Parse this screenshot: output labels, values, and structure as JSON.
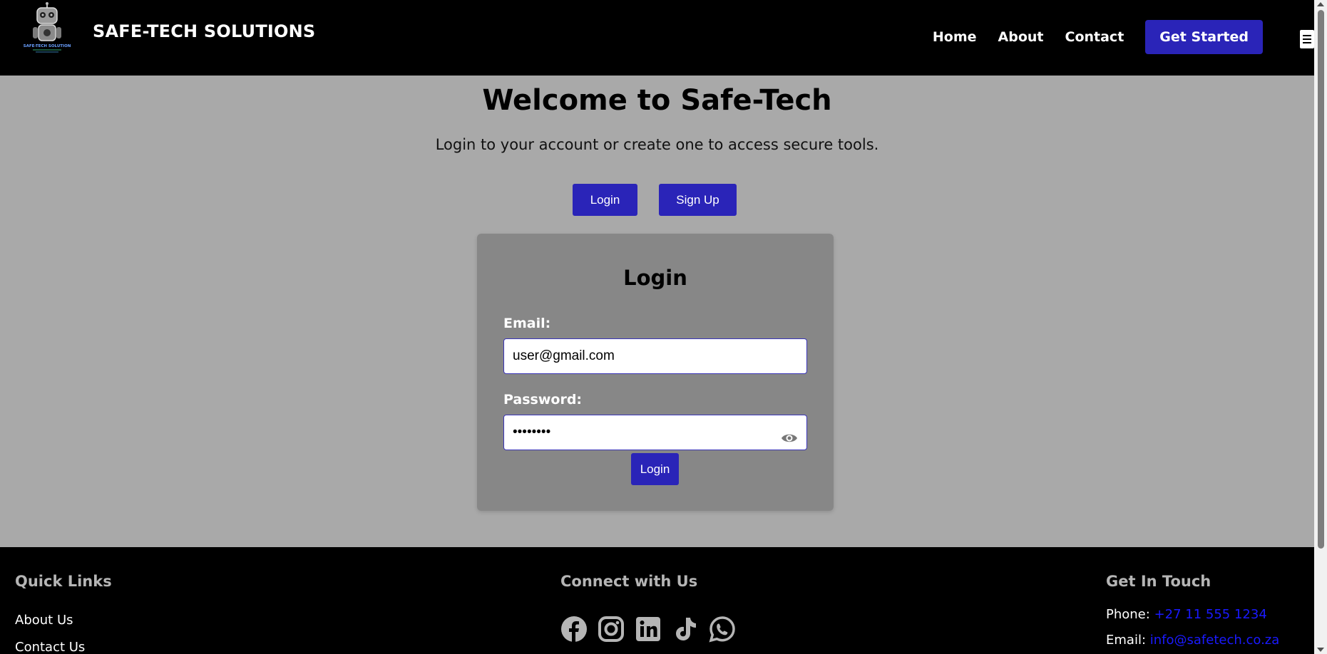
{
  "header": {
    "brand": "SAFE-TECH SOLUTIONS",
    "logo_icon": "robot-logo-icon",
    "logo_text": "SAFE-TECH SOLUTION",
    "nav": [
      {
        "label": "Home"
      },
      {
        "label": "About"
      },
      {
        "label": "Contact"
      }
    ],
    "cta_label": "Get Started",
    "menu_icon": "hamburger-menu-icon"
  },
  "hero": {
    "title": "Welcome to Safe-Tech",
    "subtitle": "Login to your account or create one to access secure tools.",
    "login_toggle": "Login",
    "signup_toggle": "Sign Up"
  },
  "login_form": {
    "title": "Login",
    "email_label": "Email:",
    "email_value": "user@gmail.com",
    "password_label": "Password:",
    "password_value": "••••••••",
    "password_toggle_icon": "eye-icon",
    "submit_label": "Login"
  },
  "footer": {
    "quick_links": {
      "heading": "Quick Links",
      "links": [
        "About Us",
        "Contact Us"
      ]
    },
    "connect": {
      "heading": "Connect with Us",
      "icons": [
        "facebook-icon",
        "instagram-icon",
        "linkedin-icon",
        "tiktok-icon",
        "whatsapp-icon"
      ]
    },
    "get_in_touch": {
      "heading": "Get In Touch",
      "phone_label": "Phone:",
      "phone_value": "+27 11 555 1234",
      "email_label": "Email:",
      "email_value": "info@safetech.co.za"
    }
  },
  "colors": {
    "accent": "#2a24b8",
    "header_bg": "#000000",
    "page_bg": "#a9a9a9",
    "card_bg": "#878787",
    "link_blue": "#1a1aff"
  }
}
